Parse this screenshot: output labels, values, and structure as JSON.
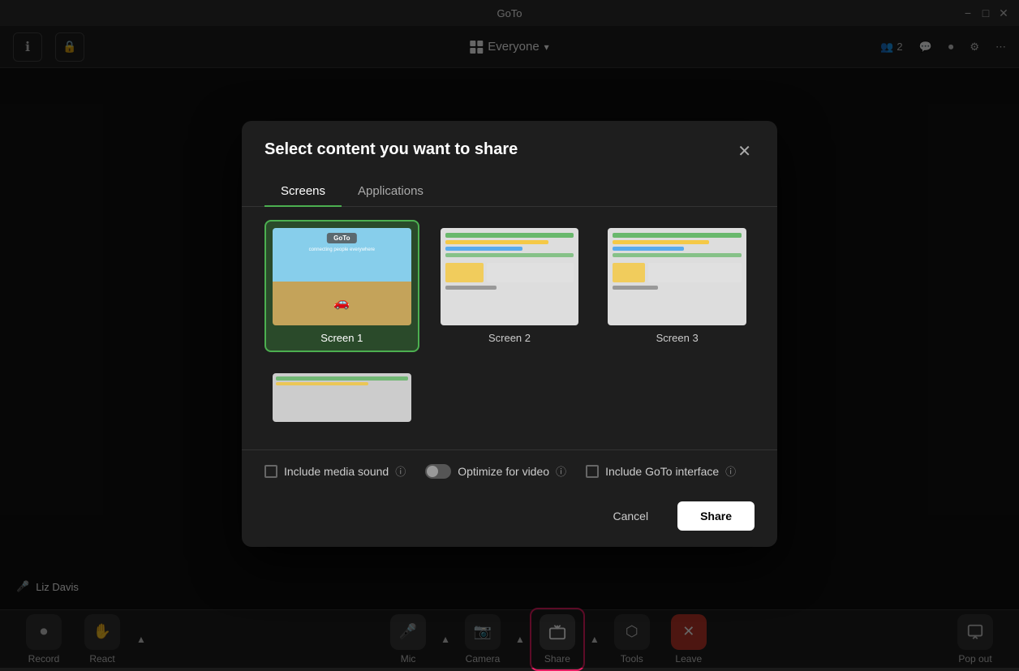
{
  "app": {
    "title": "GoTo"
  },
  "titleBar": {
    "title": "GoTo",
    "minimizeLabel": "−",
    "maximizeLabel": "□",
    "closeLabel": "✕"
  },
  "navBar": {
    "infoIconLabel": "ℹ",
    "lockIconLabel": "🔒",
    "roomLabel": "Everyone",
    "chevronLabel": "▾",
    "participantCount": "2",
    "chatIconLabel": "💬",
    "recordIconLabel": "⏺",
    "settingsIconLabel": "⚙",
    "moreIconLabel": "⋯"
  },
  "participant": {
    "name": "Liz Davis",
    "micLabel": "🎤"
  },
  "toolbar": {
    "record": {
      "label": "Record",
      "icon": "⏺"
    },
    "react": {
      "label": "React",
      "icon": "✋"
    },
    "reactChevron": "▲",
    "mic": {
      "label": "Mic",
      "icon": "🎤"
    },
    "micChevron": "▲",
    "camera": {
      "label": "Camera",
      "icon": "📷"
    },
    "cameraChevron": "▲",
    "share": {
      "label": "Share",
      "icon": "⬛"
    },
    "shareChevron": "▲",
    "tools": {
      "label": "Tools",
      "icon": "⬡"
    },
    "leave": {
      "label": "Leave",
      "icon": "✕"
    },
    "popout": {
      "label": "Pop out",
      "icon": "⤢"
    }
  },
  "modal": {
    "title": "Select content you want to share",
    "closeLabel": "✕",
    "tabs": [
      {
        "id": "screens",
        "label": "Screens",
        "active": true
      },
      {
        "id": "applications",
        "label": "Applications",
        "active": false
      }
    ],
    "screens": [
      {
        "id": "screen1",
        "label": "Screen 1",
        "selected": true
      },
      {
        "id": "screen2",
        "label": "Screen 2",
        "selected": false
      },
      {
        "id": "screen3",
        "label": "Screen 3",
        "selected": false
      },
      {
        "id": "screen4",
        "label": "",
        "selected": false
      }
    ],
    "options": {
      "includeMediaSound": {
        "label": "Include media sound",
        "infoIcon": "ⓘ",
        "checked": false
      },
      "optimizeForVideo": {
        "label": "Optimize for video",
        "infoIcon": "ⓘ",
        "checked": false
      },
      "includeGoToInterface": {
        "label": "Include GoTo interface",
        "infoIcon": "ⓘ",
        "checked": false
      }
    },
    "cancelLabel": "Cancel",
    "shareLabel": "Share"
  }
}
